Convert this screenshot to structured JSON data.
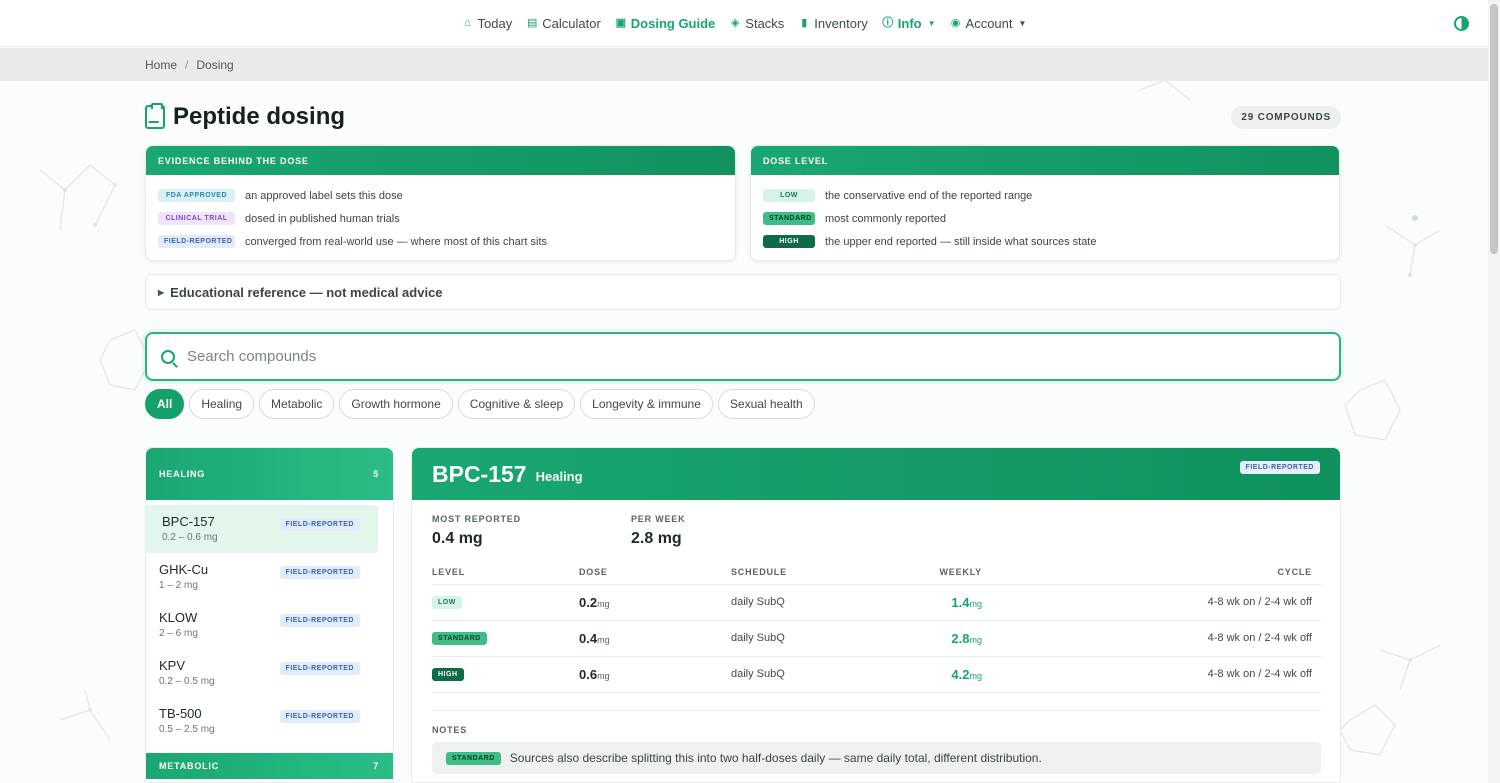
{
  "nav": {
    "items": [
      {
        "label": "Today",
        "icon": "home-icon"
      },
      {
        "label": "Calculator",
        "icon": "calculator-icon"
      },
      {
        "label": "Dosing Guide",
        "icon": "clipboard-icon"
      },
      {
        "label": "Stacks",
        "icon": "layers-icon"
      },
      {
        "label": "Inventory",
        "icon": "vial-icon"
      },
      {
        "label": "Info",
        "icon": "info-icon"
      },
      {
        "label": "Account",
        "icon": "user-icon"
      }
    ]
  },
  "breadcrumb": {
    "home": "Home",
    "current": "Dosing"
  },
  "page": {
    "title": "Peptide dosing",
    "count": "29 COMPOUNDS"
  },
  "evidence": {
    "title": "EVIDENCE BEHIND THE DOSE",
    "rows": [
      {
        "badge": "FDA APPROVED",
        "text": "an approved label sets this dose"
      },
      {
        "badge": "CLINICAL TRIAL",
        "text": "dosed in published human trials"
      },
      {
        "badge": "FIELD-REPORTED",
        "text": "converged from real-world use — where most of this chart sits"
      }
    ]
  },
  "dose_level": {
    "title": "DOSE LEVEL",
    "rows": [
      {
        "badge": "LOW",
        "text": "the conservative end of the reported range"
      },
      {
        "badge": "STANDARD",
        "text": "most commonly reported"
      },
      {
        "badge": "HIGH",
        "text": "the upper end reported — still inside what sources state"
      }
    ]
  },
  "disclaimer": "Educational reference — not medical advice",
  "search": {
    "placeholder": "Search compounds"
  },
  "filters": [
    "All",
    "Healing",
    "Metabolic",
    "Growth hormone",
    "Cognitive & sleep",
    "Longevity & immune",
    "Sexual health"
  ],
  "list": {
    "group": {
      "name": "HEALING",
      "count": "5"
    },
    "compounds": [
      {
        "name": "BPC-157",
        "range": "0.2 – 0.6 mg",
        "badge": "FIELD-REPORTED"
      },
      {
        "name": "GHK-Cu",
        "range": "1 – 2 mg",
        "badge": "FIELD-REPORTED"
      },
      {
        "name": "KLOW",
        "range": "2 – 6 mg",
        "badge": "FIELD-REPORTED"
      },
      {
        "name": "KPV",
        "range": "0.2 – 0.5 mg",
        "badge": "FIELD-REPORTED"
      },
      {
        "name": "TB-500",
        "range": "0.5 – 2.5 mg",
        "badge": "FIELD-REPORTED"
      }
    ],
    "next_group": {
      "name": "METABOLIC",
      "count": "7"
    }
  },
  "detail": {
    "name": "BPC-157",
    "category": "Healing",
    "badge": "FIELD-REPORTED",
    "most_reported_label": "MOST REPORTED",
    "most_reported": "0.4 mg",
    "per_week_label": "PER WEEK",
    "per_week": "2.8 mg",
    "columns": [
      "LEVEL",
      "DOSE",
      "SCHEDULE",
      "WEEKLY",
      "CYCLE"
    ],
    "rows": [
      {
        "level": "LOW",
        "dose": "0.2",
        "unit": "mg",
        "schedule": "daily SubQ",
        "weekly": "1.4",
        "weekly_unit": "mg",
        "cycle": "4-8 wk on / 2-4 wk off"
      },
      {
        "level": "STANDARD",
        "dose": "0.4",
        "unit": "mg",
        "schedule": "daily SubQ",
        "weekly": "2.8",
        "weekly_unit": "mg",
        "cycle": "4-8 wk on / 2-4 wk off"
      },
      {
        "level": "HIGH",
        "dose": "0.6",
        "unit": "mg",
        "schedule": "daily SubQ",
        "weekly": "4.2",
        "weekly_unit": "mg",
        "cycle": "4-8 wk on / 2-4 wk off"
      }
    ],
    "notes_label": "NOTES",
    "note": {
      "badge": "STANDARD",
      "text": "Sources also describe splitting this into two half-doses daily — same daily total, different distribution."
    }
  },
  "colors": {
    "accent": "#17a56f",
    "accent_dark": "#0e6b45"
  }
}
